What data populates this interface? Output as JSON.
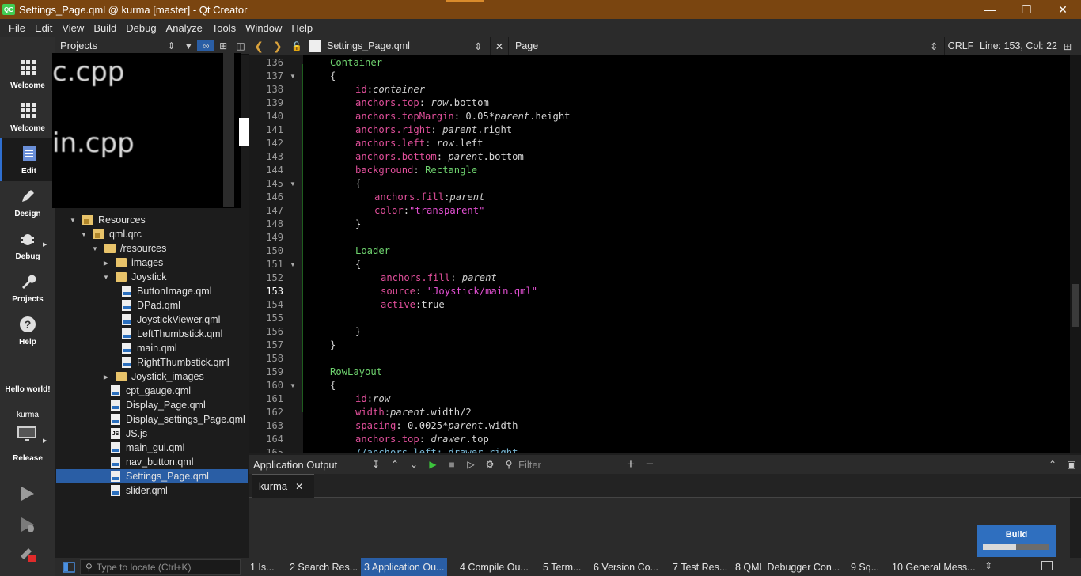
{
  "window": {
    "title": "Settings_Page.qml @ kurma [master] - Qt Creator",
    "app_icon": "QC"
  },
  "menubar": [
    "File",
    "Edit",
    "View",
    "Build",
    "Debug",
    "Analyze",
    "Tools",
    "Window",
    "Help"
  ],
  "modes": [
    {
      "label": "Welcome",
      "icon": "welcome-grid-icon"
    },
    {
      "label": "Welcome",
      "icon": "welcome-grid-icon"
    },
    {
      "label": "Edit",
      "icon": "edit-doc-icon"
    },
    {
      "label": "Design",
      "icon": "design-pen-icon"
    },
    {
      "label": "Debug",
      "icon": "debug-bug-icon"
    },
    {
      "label": "Projects",
      "icon": "projects-wrench-icon"
    },
    {
      "label": "Help",
      "icon": "help-question-icon"
    }
  ],
  "session": {
    "project": "Hello world!",
    "kit": "kurma",
    "build_config": "Release"
  },
  "projects_pane": {
    "title": "Projects",
    "preview_text_1": "c.cpp",
    "preview_text_2": "in.cpp",
    "tree": [
      {
        "label": "Resources",
        "kind": "folder-lock",
        "expanded": true
      },
      {
        "label": "qml.qrc",
        "kind": "lock",
        "expanded": true
      },
      {
        "label": "/resources",
        "kind": "folder",
        "expanded": true
      },
      {
        "label": "images",
        "kind": "folder",
        "expanded": false
      },
      {
        "label": "Joystick",
        "kind": "folder",
        "expanded": true
      },
      {
        "label": "ButtonImage.qml",
        "kind": "qml"
      },
      {
        "label": "DPad.qml",
        "kind": "qml"
      },
      {
        "label": "JoystickViewer.qml",
        "kind": "qml"
      },
      {
        "label": "LeftThumbstick.qml",
        "kind": "qml"
      },
      {
        "label": "main.qml",
        "kind": "qml"
      },
      {
        "label": "RightThumbstick.qml",
        "kind": "qml"
      },
      {
        "label": "Joystick_images",
        "kind": "folder",
        "expanded": false
      },
      {
        "label": "cpt_gauge.qml",
        "kind": "qml"
      },
      {
        "label": "Display_Page.qml",
        "kind": "qml"
      },
      {
        "label": "Display_settings_Page.qml",
        "kind": "qml"
      },
      {
        "label": "JS.js",
        "kind": "js"
      },
      {
        "label": "main_gui.qml",
        "kind": "qml"
      },
      {
        "label": "nav_button.qml",
        "kind": "qml"
      },
      {
        "label": "Settings_Page.qml",
        "kind": "qml",
        "selected": true
      },
      {
        "label": "slider.qml",
        "kind": "qml"
      }
    ]
  },
  "editor_toolbar": {
    "file": "Settings_Page.qml",
    "symbol": "Page",
    "line_ending": "CRLF",
    "position": "Line: 153, Col: 22"
  },
  "editor": {
    "current_line": 153,
    "lines": [
      {
        "n": "136",
        "fold": false,
        "parts": [
          [
            "t",
            "Container"
          ]
        ]
      },
      {
        "n": "137",
        "fold": true,
        "parts": [
          [
            "p",
            "{"
          ]
        ]
      },
      {
        "n": "138",
        "fold": false,
        "parts": [
          [
            "pr",
            "id"
          ],
          [
            "p",
            ":"
          ],
          [
            "i",
            "container"
          ]
        ]
      },
      {
        "n": "139",
        "fold": false,
        "parts": [
          [
            "pr",
            "anchors.top"
          ],
          [
            "p",
            ": "
          ],
          [
            "i",
            "row"
          ],
          [
            "p",
            ".bottom"
          ]
        ]
      },
      {
        "n": "140",
        "fold": false,
        "parts": [
          [
            "pr",
            "anchors.topMargin"
          ],
          [
            "p",
            ": 0.05*"
          ],
          [
            "i",
            "parent"
          ],
          [
            "p",
            ".height"
          ]
        ]
      },
      {
        "n": "141",
        "fold": false,
        "parts": [
          [
            "pr",
            "anchors.right"
          ],
          [
            "p",
            ": "
          ],
          [
            "i",
            "parent"
          ],
          [
            "p",
            ".right"
          ]
        ]
      },
      {
        "n": "142",
        "fold": false,
        "parts": [
          [
            "pr",
            "anchors.left"
          ],
          [
            "p",
            ": "
          ],
          [
            "i",
            "row"
          ],
          [
            "p",
            ".left"
          ]
        ]
      },
      {
        "n": "143",
        "fold": false,
        "parts": [
          [
            "pr",
            "anchors.bottom"
          ],
          [
            "p",
            ": "
          ],
          [
            "i",
            "parent"
          ],
          [
            "p",
            ".bottom"
          ]
        ]
      },
      {
        "n": "144",
        "fold": false,
        "parts": [
          [
            "pr",
            "background"
          ],
          [
            "p",
            ": "
          ],
          [
            "t",
            "Rectangle"
          ]
        ]
      },
      {
        "n": "145",
        "fold": true,
        "parts": [
          [
            "p",
            "{"
          ]
        ]
      },
      {
        "n": "146",
        "fold": false,
        "parts": [
          [
            "pr",
            "anchors.fill"
          ],
          [
            "p",
            ":"
          ],
          [
            "i",
            "parent"
          ]
        ]
      },
      {
        "n": "147",
        "fold": false,
        "parts": [
          [
            "pr",
            "color"
          ],
          [
            "p",
            ":"
          ],
          [
            "s",
            "\"transparent\""
          ]
        ]
      },
      {
        "n": "148",
        "fold": false,
        "parts": [
          [
            "p",
            "}"
          ]
        ]
      },
      {
        "n": "149",
        "fold": false,
        "parts": []
      },
      {
        "n": "150",
        "fold": false,
        "parts": [
          [
            "t",
            "Loader"
          ]
        ]
      },
      {
        "n": "151",
        "fold": true,
        "parts": [
          [
            "p",
            "{"
          ]
        ]
      },
      {
        "n": "152",
        "fold": false,
        "parts": [
          [
            "pr",
            "anchors.fill"
          ],
          [
            "p",
            ": "
          ],
          [
            "i",
            "parent"
          ]
        ]
      },
      {
        "n": "153",
        "fold": false,
        "parts": [
          [
            "pr",
            "source"
          ],
          [
            "p",
            ": "
          ],
          [
            "s",
            "\"Joystick/main.qml\""
          ]
        ]
      },
      {
        "n": "154",
        "fold": false,
        "parts": [
          [
            "pr",
            "active"
          ],
          [
            "p",
            ":true"
          ]
        ]
      },
      {
        "n": "155",
        "fold": false,
        "parts": []
      },
      {
        "n": "156",
        "fold": false,
        "parts": [
          [
            "p",
            "}"
          ]
        ]
      },
      {
        "n": "157",
        "fold": false,
        "parts": [
          [
            "p",
            "}"
          ]
        ]
      },
      {
        "n": "158",
        "fold": false,
        "parts": []
      },
      {
        "n": "159",
        "fold": false,
        "parts": [
          [
            "t",
            "RowLayout"
          ]
        ]
      },
      {
        "n": "160",
        "fold": true,
        "parts": [
          [
            "p",
            "{"
          ]
        ]
      },
      {
        "n": "161",
        "fold": false,
        "parts": [
          [
            "pr",
            "id"
          ],
          [
            "p",
            ":"
          ],
          [
            "i",
            "row"
          ]
        ]
      },
      {
        "n": "162",
        "fold": false,
        "parts": [
          [
            "pr",
            "width"
          ],
          [
            "p",
            ":"
          ],
          [
            "i",
            "parent"
          ],
          [
            "p",
            ".width/2"
          ]
        ]
      },
      {
        "n": "163",
        "fold": false,
        "parts": [
          [
            "pr",
            "spacing"
          ],
          [
            "p",
            ": 0.0025*"
          ],
          [
            "i",
            "parent"
          ],
          [
            "p",
            ".width"
          ]
        ]
      },
      {
        "n": "164",
        "fold": false,
        "parts": [
          [
            "pr",
            "anchors.top"
          ],
          [
            "p",
            ": "
          ],
          [
            "i",
            "drawer"
          ],
          [
            "p",
            ".top"
          ]
        ]
      },
      {
        "n": "165",
        "fold": false,
        "parts": [
          [
            "c",
            "//anchors.left: drawer.right"
          ]
        ]
      }
    ]
  },
  "output_pane": {
    "title": "Application Output",
    "filter_placeholder": "Filter",
    "tab": "kurma"
  },
  "build_progress": {
    "label": "Build",
    "fraction": 0.5
  },
  "statusbar": {
    "locator_placeholder": "Type to locate (Ctrl+K)",
    "tabs": [
      "1  Is...",
      "2  Search Res...",
      "3  Application Ou...",
      "4  Compile Ou...",
      "5  Term...",
      "6  Version Co...",
      "7  Test Res...",
      "8  QML Debugger Con...",
      "9  Sq...",
      "10  General Mess..."
    ],
    "active_tab": 2
  },
  "colors": {
    "titlebar": "#7a4510",
    "selection": "#2a5ea5",
    "type": "#6ed26e",
    "property": "#e04f9a",
    "string": "#e04fd0"
  }
}
